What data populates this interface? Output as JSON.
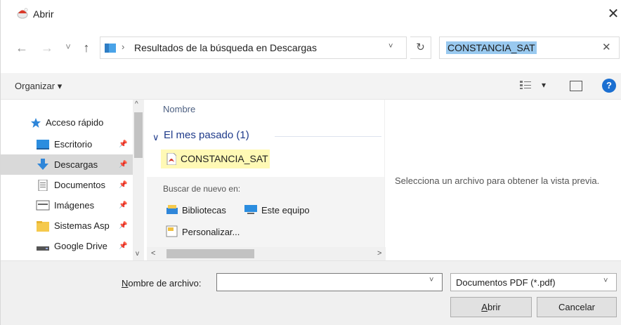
{
  "window": {
    "title": "Abrir",
    "close_glyph": "✕"
  },
  "nav": {
    "back_glyph": "←",
    "forward_glyph": "→",
    "history_glyph": "˅",
    "up_glyph": "↑",
    "address_sep": "›",
    "address": "Resultados de la búsqueda en Descargas",
    "address_dropdown": "˅",
    "refresh_glyph": "↻",
    "search_value": "CONSTANCIA_SAT",
    "search_clear": "✕"
  },
  "toolbar": {
    "organize_label": "Organizar ▾",
    "view_dropdown": "▾",
    "help_glyph": "?"
  },
  "sidebar": {
    "quick_access": "Acceso rápido",
    "items": [
      {
        "label": "Escritorio",
        "icon": "desktop-icon"
      },
      {
        "label": "Descargas",
        "icon": "download-icon"
      },
      {
        "label": "Documentos",
        "icon": "documents-icon"
      },
      {
        "label": "Imágenes",
        "icon": "pictures-icon"
      },
      {
        "label": "Sistemas Asp",
        "icon": "folder-icon"
      },
      {
        "label": "Google Drive",
        "icon": "drive-icon"
      }
    ],
    "pin_glyph": "📌",
    "scroll_up": "^",
    "scroll_down": "v"
  },
  "filelist": {
    "column_name": "Nombre",
    "group_label": "El mes pasado (1)",
    "group_chevron": "∨",
    "file": "CONSTANCIA_SAT",
    "search_again_label": "Buscar de nuevo en:",
    "libraries": "Bibliotecas",
    "this_pc": "Este equipo",
    "customize": "Personalizar...",
    "scroll_left": "<",
    "scroll_right": ">"
  },
  "preview": {
    "message": "Selecciona un archivo para obtener la vista previa."
  },
  "footer": {
    "filename_label_first": "N",
    "filename_label_rest": "ombre de archivo:",
    "filename_value": "",
    "filename_dropdown": "˅",
    "filetype": "Documentos PDF (*.pdf)",
    "filetype_dropdown": "˅",
    "open_first": "A",
    "open_rest": "brir",
    "cancel": "Cancelar"
  },
  "colors": {
    "accent": "#1b6fd1",
    "highlight": "#fff9b5",
    "selection": "#99c9ef"
  }
}
